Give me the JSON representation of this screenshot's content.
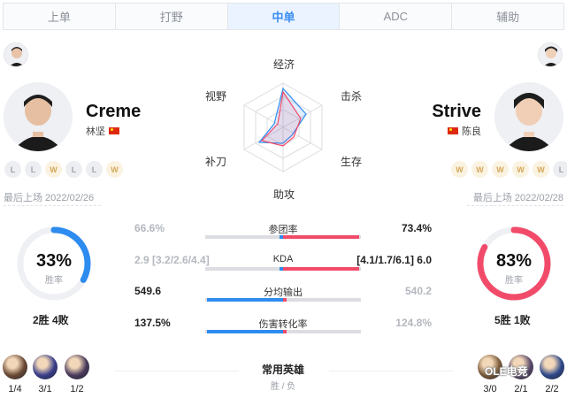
{
  "tabs": [
    {
      "label": "上单",
      "active": false
    },
    {
      "label": "打野",
      "active": false
    },
    {
      "label": "中单",
      "active": true
    },
    {
      "label": "ADC",
      "active": false
    },
    {
      "label": "辅助",
      "active": false
    }
  ],
  "left_player": {
    "name": "Creme",
    "real_name": "林坚",
    "results": [
      "L",
      "L",
      "W",
      "L",
      "L",
      "W"
    ],
    "last_played": "最后上场 2022/02/26",
    "win_rate_text": "33%",
    "win_rate": 0.33,
    "win_rate_label": "胜率",
    "record": "2胜 4败",
    "heroes": [
      {
        "score": "1/4",
        "color": "#6b4a35"
      },
      {
        "score": "3/1",
        "color": "#3a3f8a"
      },
      {
        "score": "1/2",
        "color": "#4a3b5c"
      }
    ]
  },
  "right_player": {
    "name": "Strive",
    "real_name": "陈良",
    "results": [
      "W",
      "W",
      "W",
      "W",
      "W",
      "L"
    ],
    "last_played": "最后上场 2022/02/28",
    "win_rate_text": "83%",
    "win_rate": 0.83,
    "win_rate_label": "胜率",
    "record": "5胜 1败",
    "heroes": [
      {
        "score": "3/0",
        "color": "#7a5a3a"
      },
      {
        "score": "2/1",
        "color": "#5a4a6b"
      },
      {
        "score": "2/2",
        "color": "#2e4a8a"
      }
    ]
  },
  "radar": {
    "labels": {
      "top": "经济",
      "top_right": "击杀",
      "bottom_right": "生存",
      "bottom": "助攻",
      "bottom_left": "补刀",
      "top_left": "视野"
    }
  },
  "stats": [
    {
      "label": "参团率",
      "left": "66.6%",
      "right": "73.4%",
      "left_fill": 0.05,
      "right_fill": 0.98,
      "left_strong": false,
      "right_strong": true
    },
    {
      "label": "KDA",
      "left": "2.9 [3.2/2.6/4.4]",
      "right": "[4.1/1.7/6.1] 6.0",
      "left_fill": 0.05,
      "right_fill": 0.98,
      "left_strong": false,
      "right_strong": true
    },
    {
      "label": "分均输出",
      "left": "549.6",
      "right": "540.2",
      "left_fill": 0.98,
      "right_fill": 0.05,
      "left_strong": true,
      "right_strong": false
    },
    {
      "label": "伤害转化率",
      "left": "137.5%",
      "right": "124.8%",
      "left_fill": 0.98,
      "right_fill": 0.05,
      "left_strong": true,
      "right_strong": false
    }
  ],
  "heroes_section": {
    "title": "常用英雄",
    "subtitle": "胜 / 负"
  },
  "watermark": "OLE电竞",
  "colors": {
    "blue": "#2e8cf0",
    "red": "#f24b6a",
    "track": "#e6e8ee",
    "accent_tab": "#3a8df5"
  }
}
